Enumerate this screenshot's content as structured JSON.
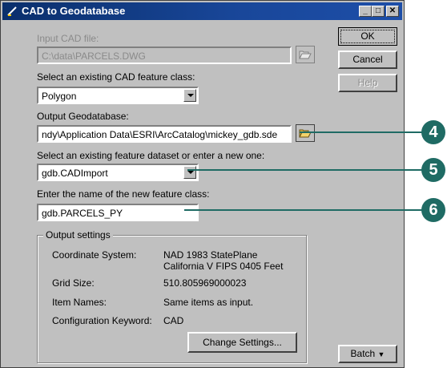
{
  "window": {
    "title": "CAD to Geodatabase",
    "controls": [
      "_",
      "□",
      "✕"
    ]
  },
  "input_cad": {
    "label": "Input CAD file:",
    "value": "C:\\data\\PARCELS.DWG"
  },
  "feature_class": {
    "label": "Select an existing CAD feature class:",
    "value": "Polygon"
  },
  "output_gdb": {
    "label": "Output Geodatabase:",
    "value": "ndy\\Application Data\\ESRI\\ArcCatalog\\mickey_gdb.sde"
  },
  "dataset": {
    "label": "Select an existing feature dataset or enter a new one:",
    "value": "gdb.CADImport"
  },
  "new_class": {
    "label": "Enter the name of the new feature class:",
    "value": "gdb.PARCELS_PY"
  },
  "settings": {
    "title": "Output settings",
    "rows": [
      {
        "label": "Coordinate System:",
        "value": "NAD 1983 StatePlane",
        "value2": "California V FIPS 0405 Feet"
      },
      {
        "label": "Grid Size:",
        "value": "510.805969000023"
      },
      {
        "label": "Item Names:",
        "value": "Same items as input."
      },
      {
        "label": "Configuration Keyword:",
        "value": "CAD"
      }
    ],
    "change_button": "Change Settings..."
  },
  "buttons": {
    "ok": "OK",
    "cancel": "Cancel",
    "help": "Help",
    "batch": "Batch"
  },
  "callouts": [
    "4",
    "5",
    "6"
  ],
  "colors": {
    "titlebar": "#0a2f6c",
    "face": "#c0c0c0",
    "callout": "#1f6b64"
  }
}
